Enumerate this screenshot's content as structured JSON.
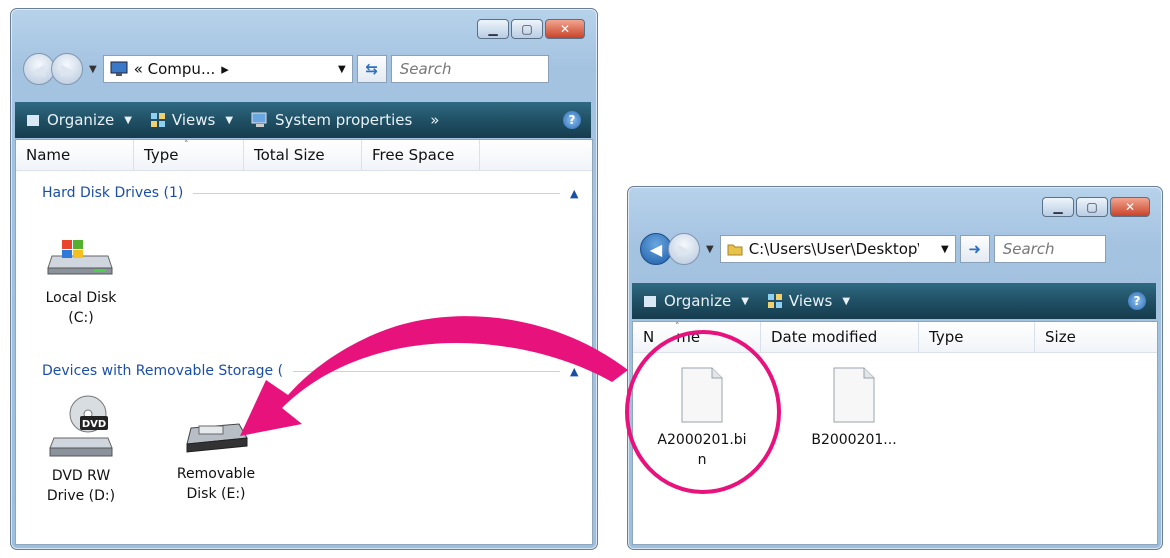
{
  "left_window": {
    "breadcrumb": "« Compu...",
    "breadcrumb_sep": "▸",
    "search_placeholder": "Search",
    "toolbar": {
      "organize": "Organize",
      "views": "Views",
      "system_properties": "System properties",
      "more": "»"
    },
    "columns": [
      "Name",
      "Type",
      "Total Size",
      "Free Space"
    ],
    "groups": [
      {
        "title": "Hard Disk Drives (1)",
        "items": [
          {
            "label_line1": "Local Disk",
            "label_line2": "(C:)",
            "icon": "hard-drive-icon"
          }
        ]
      },
      {
        "title": "Devices with Removable Storage (",
        "items": [
          {
            "label_line1": "DVD RW",
            "label_line2": "Drive (D:)",
            "icon": "dvd-drive-icon",
            "badge": "DVD"
          },
          {
            "label_line1": "Removable",
            "label_line2": "Disk (E:)",
            "icon": "removable-disk-icon"
          }
        ]
      }
    ]
  },
  "right_window": {
    "address": "C:\\Users\\User\\Desktop\\",
    "search_placeholder": "Search",
    "toolbar": {
      "organize": "Organize",
      "views": "Views"
    },
    "columns": [
      "N",
      "me",
      "Date modified",
      "Type",
      "Size"
    ],
    "files": [
      {
        "label_line1": "A2000201.bi",
        "label_line2": "n",
        "icon": "file-icon",
        "highlighted": true
      },
      {
        "label_line1": "B2000201...",
        "label_line2": "",
        "icon": "file-icon"
      }
    ]
  },
  "colors": {
    "arrow": "#e8127c",
    "group_text": "#1b4fa6",
    "toolbar_bg": "#1f4e62"
  }
}
